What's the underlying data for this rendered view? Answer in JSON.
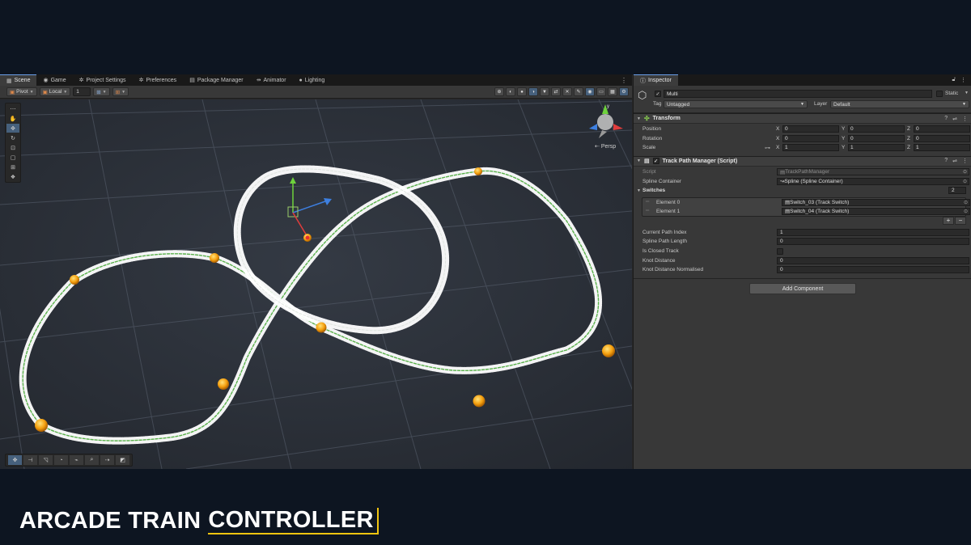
{
  "scene_tabs": [
    {
      "label": "Scene",
      "icon": "grid-icon"
    },
    {
      "label": "Game",
      "icon": "gamepad-icon"
    },
    {
      "label": "Project Settings",
      "icon": "gear-icon"
    },
    {
      "label": "Preferences",
      "icon": "gear-icon"
    },
    {
      "label": "Package Manager",
      "icon": "package-icon"
    },
    {
      "label": "Animator",
      "icon": "animator-icon"
    },
    {
      "label": "Lighting",
      "icon": "bulb-icon"
    }
  ],
  "scene_toolbar": {
    "pivot": "Pivot",
    "space": "Local",
    "snap_value": "1"
  },
  "view": {
    "persp_label": "Persp"
  },
  "inspector": {
    "tab": "Inspector",
    "object_name": "Multi",
    "static_label": "Static",
    "tag_label": "Tag",
    "tag_value": "Untagged",
    "layer_label": "Layer",
    "layer_value": "Default",
    "transform": {
      "title": "Transform",
      "rows": [
        {
          "label": "Position",
          "x": "0",
          "y": "0",
          "z": "0"
        },
        {
          "label": "Rotation",
          "x": "0",
          "y": "0",
          "z": "0"
        },
        {
          "label": "Scale",
          "x": "1",
          "y": "1",
          "z": "1"
        }
      ],
      "axis_labels": [
        "X",
        "Y",
        "Z"
      ]
    },
    "script_component": {
      "title": "Track Path Manager (Script)",
      "script_label": "Script",
      "script_value": "TrackPathManager",
      "spline_label": "Spline Container",
      "spline_value": "Spline (Spline Container)",
      "switches_label": "Switches",
      "switches_count": "2",
      "elements": [
        {
          "label": "Element 0",
          "value": "Switch_03 (Track Switch)"
        },
        {
          "label": "Element 1",
          "value": "Switch_04 (Track Switch)"
        }
      ],
      "plus": "+",
      "minus": "−",
      "fields": [
        {
          "label": "Current Path Index",
          "value": "1"
        },
        {
          "label": "Spline Path Length",
          "value": "0"
        },
        {
          "label": "Is Closed Track",
          "value": ""
        },
        {
          "label": "Knot Distance",
          "value": "0"
        },
        {
          "label": "Knot Distance Normalised",
          "value": "0"
        }
      ]
    },
    "add_component": "Add Component"
  },
  "title_caption": {
    "part1": "ARCADE TRAIN",
    "part2": "CONTROLLER"
  },
  "colors": {
    "accent": "#f1c40f",
    "knot": "#f5a00f",
    "track": "#ffffff",
    "sleeper_green": "#59b04a",
    "background": "#0d1521"
  }
}
